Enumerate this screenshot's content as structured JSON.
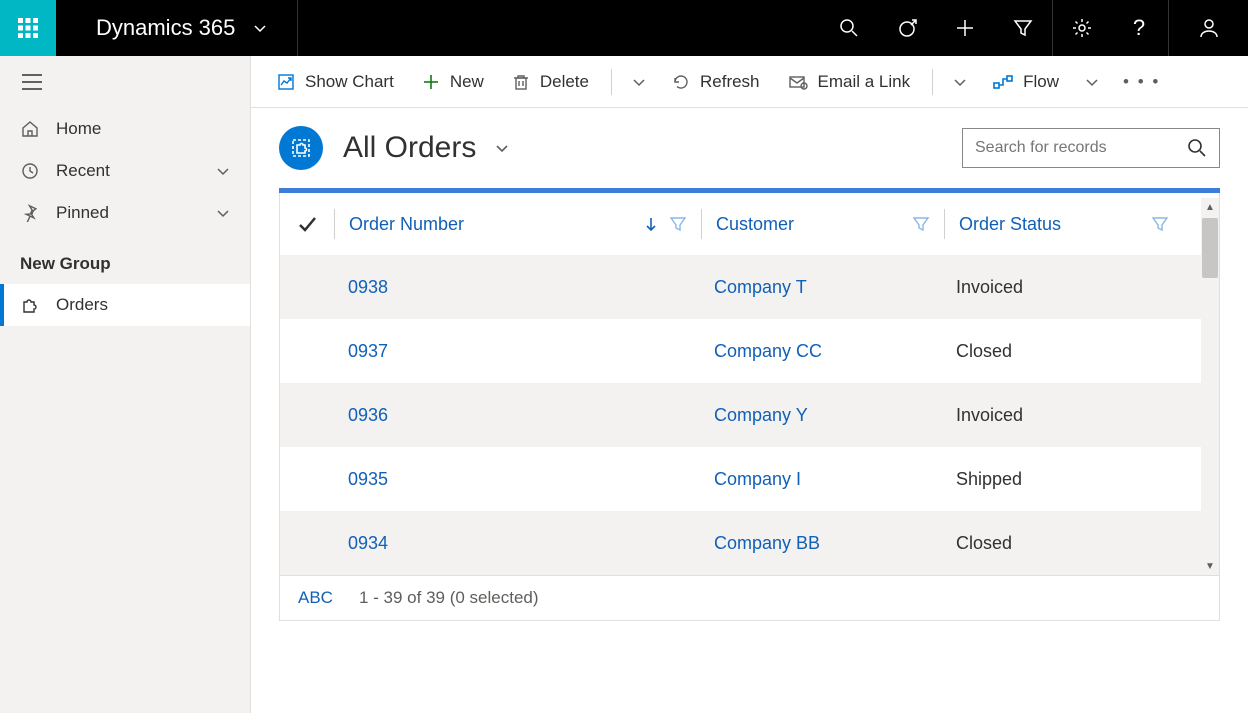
{
  "brand": {
    "name": "Dynamics 365"
  },
  "sidebar": {
    "home": "Home",
    "recent": "Recent",
    "pinned": "Pinned",
    "group_label": "New Group",
    "orders": "Orders"
  },
  "commands": {
    "show_chart": "Show Chart",
    "new": "New",
    "delete": "Delete",
    "refresh": "Refresh",
    "email_link": "Email a Link",
    "flow": "Flow"
  },
  "view": {
    "title": "All Orders",
    "search_placeholder": "Search for records"
  },
  "grid": {
    "columns": {
      "order_number": "Order Number",
      "customer": "Customer",
      "order_status": "Order Status"
    },
    "rows": [
      {
        "order": "0938",
        "customer": "Company T",
        "status": "Invoiced"
      },
      {
        "order": "0937",
        "customer": "Company CC",
        "status": "Closed"
      },
      {
        "order": "0936",
        "customer": "Company Y",
        "status": "Invoiced"
      },
      {
        "order": "0935",
        "customer": "Company I",
        "status": "Shipped"
      },
      {
        "order": "0934",
        "customer": "Company BB",
        "status": "Closed"
      }
    ]
  },
  "footer": {
    "abc": "ABC",
    "count": "1 - 39 of 39 (0 selected)"
  }
}
